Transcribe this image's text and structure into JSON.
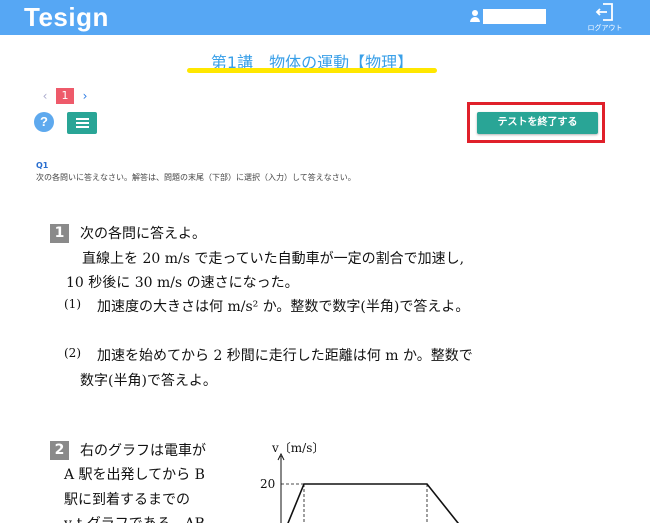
{
  "header": {
    "logo": "Tesign",
    "logout_label": "ログアウト"
  },
  "title": "第1講　物体の運動【物理】",
  "pager": {
    "prev": "‹",
    "current": "1",
    "next": "›"
  },
  "toolbar": {
    "help_label": "?",
    "end_test_label": "テストを終了する"
  },
  "question": {
    "number": "Q1",
    "instruction": "次の各問いに答えなさい。解答は、問題の末尾（下部）に選択（入力）して答えなさい。"
  },
  "problem1": {
    "box": "1",
    "lead": "次の各問に答えよ。",
    "line1": "直線上を 20 m/s で走っていた自動車が一定の割合で加速し,",
    "line2": "10 秒後に 30 m/s の速さになった。",
    "sub1_num": "(1)",
    "sub1_text": "加速度の大きさは何 m/s² か。整数で数字(半角)で答えよ。",
    "sub2_num": "(2)",
    "sub2_text": "加速を始めてから 2 秒間に走行した距離は何 m か。整数で",
    "sub2_text2": "数字(半角)で答えよ。"
  },
  "problem2": {
    "box": "2",
    "line1": "右のグラフは電車が",
    "line2": "A 駅を出発してから B",
    "line3": "駅に到着するまでの",
    "line4": "v-t グラフである。AB",
    "graph_ylabel": "v〔m/s〕",
    "graph_tick": "20"
  }
}
